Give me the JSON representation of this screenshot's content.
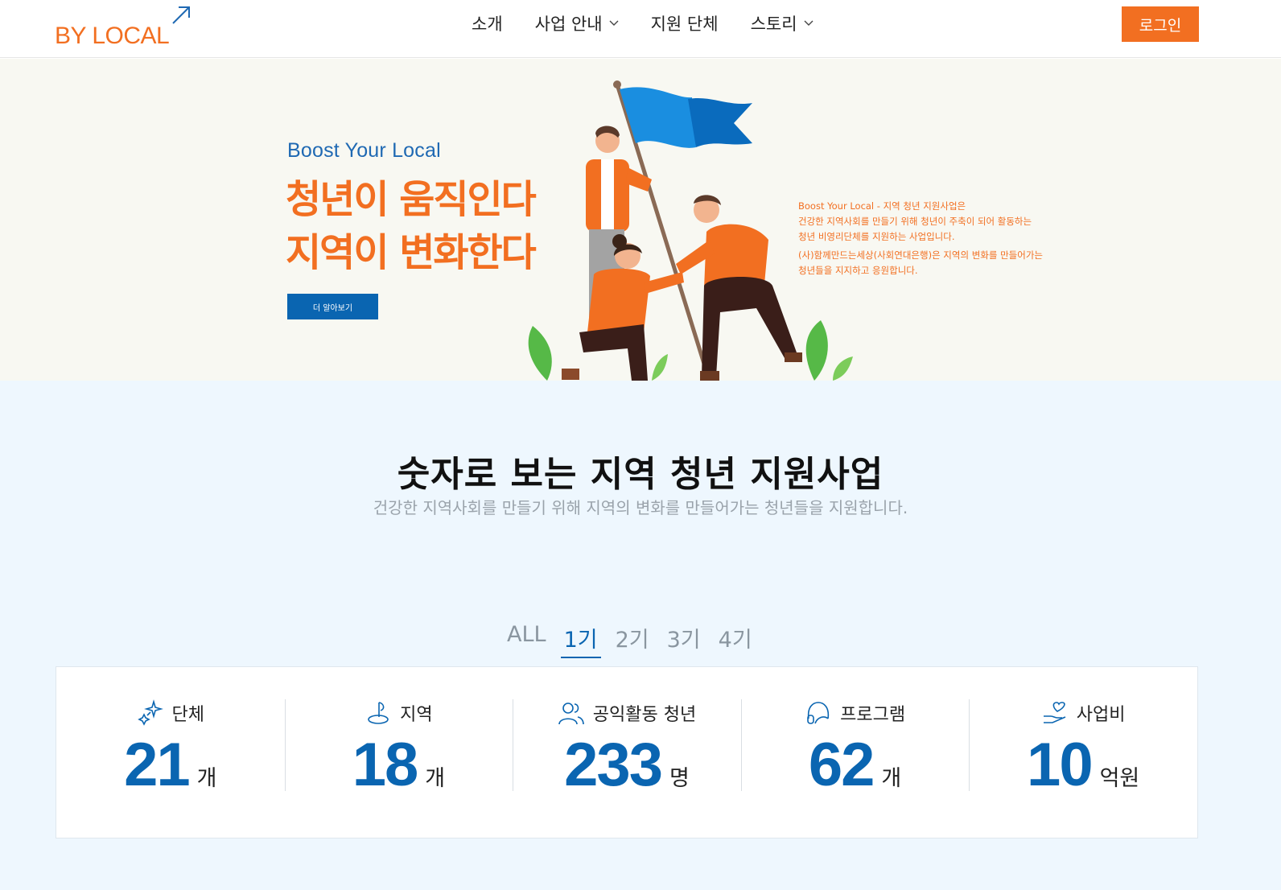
{
  "header": {
    "logo_text": "BY LOCAL",
    "nav": [
      {
        "label": "소개",
        "has_dropdown": false
      },
      {
        "label": "사업 안내",
        "has_dropdown": true
      },
      {
        "label": "지원 단체",
        "has_dropdown": false
      },
      {
        "label": "스토리",
        "has_dropdown": true
      }
    ],
    "login_label": "로그인"
  },
  "hero": {
    "eyebrow": "Boost Your Local",
    "title_line1": "청년이 움직인다",
    "title_line2": "지역이 변화한다",
    "cta_label": "더 알아보기",
    "desc1_line1": "Boost Your Local - 지역 청년 지원사업은",
    "desc1_line2": "건강한 지역사회를 만들기 위해 청년이 주축이 되어 활동하는",
    "desc1_line3": "청년 비영리단체를 지원하는 사업입니다.",
    "desc2_line1": "(사)함께만드는세상(사회연대은행)은 지역의 변화를 만들어가는",
    "desc2_line2": "청년들을 지지하고 응원합니다."
  },
  "stats": {
    "title": "숫자로 보는 지역 청년 지원사업",
    "subtitle": "건강한 지역사회를 만들기 위해 지역의 변화를 만들어가는 청년들을 지원합니다.",
    "tabs": [
      {
        "label": "ALL",
        "active": false
      },
      {
        "label": "1기",
        "active": true
      },
      {
        "label": "2기",
        "active": false
      },
      {
        "label": "3기",
        "active": false
      },
      {
        "label": "4기",
        "active": false
      }
    ],
    "items": [
      {
        "label": "단체",
        "value": "21",
        "unit": "개",
        "icon": "sparkle-icon"
      },
      {
        "label": "지역",
        "value": "18",
        "unit": "개",
        "icon": "location-pin-icon"
      },
      {
        "label": "공익활동 청년",
        "value": "233",
        "unit": "명",
        "icon": "users-icon"
      },
      {
        "label": "프로그램",
        "value": "62",
        "unit": "개",
        "icon": "headset-icon"
      },
      {
        "label": "사업비",
        "value": "10",
        "unit": "억원",
        "icon": "hand-heart-icon"
      }
    ]
  },
  "colors": {
    "brand_orange": "#f26f21",
    "brand_blue": "#0a65b1",
    "hero_bg": "#f8f8f2",
    "stats_bg": "#eef7fe"
  }
}
